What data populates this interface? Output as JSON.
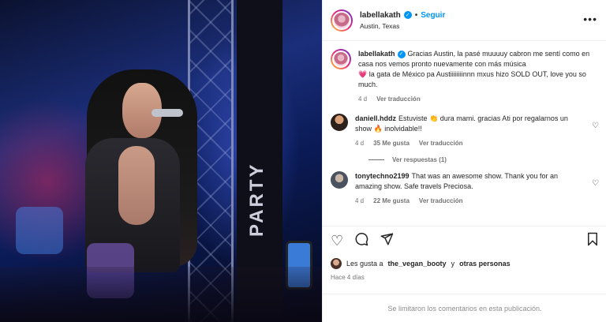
{
  "photo": {
    "banner_text": "PARTY"
  },
  "header": {
    "username": "labellakath",
    "verified_glyph": "✓",
    "separator": "•",
    "follow_label": "Seguir",
    "location": "Austin, Texas",
    "more_icon": "more-dots-icon"
  },
  "caption": {
    "username": "labellakath",
    "text_part1": "Gracias Austin, la pasé muuuuy cabron me sentí como en casa nos vemos pronto nuevamente con más música",
    "emoji_heart": "💗",
    "text_part2": "la gata de México pa Austiiiiiiiinnn mxus hizo SOLD OUT, love you so much.",
    "age": "4 d",
    "translate": "Ver traducción"
  },
  "comments": [
    {
      "username": "daniell.hddz",
      "text_part1": "Estuviste",
      "emoji1": "👏",
      "text_part2": "dura mami. gracias Ati por regalarnos un show",
      "emoji2": "🔥",
      "text_part3": "inolvidable!!",
      "age": "4 d",
      "likes": "35 Me gusta",
      "translate": "Ver traducción",
      "replies": "Ver respuestas (1)"
    },
    {
      "username": "tonytechno2199",
      "text": "That was an awesome show. Thank you for an amazing show. Safe travels Preciosa.",
      "age": "4 d",
      "likes": "22 Me gusta",
      "translate": "Ver traducción"
    }
  ],
  "actions": {
    "like_icon": "heart-outline-icon",
    "comment_icon": "comment-bubble-icon",
    "share_icon": "paper-plane-icon",
    "save_icon": "bookmark-icon"
  },
  "likes": {
    "prefix": "Les gusta a",
    "user": "the_vegan_booty",
    "middle": "y",
    "others": "otras personas"
  },
  "time": "Hace 4 días",
  "comments_limited": "Se limitaron los comentarios en esta publicación.",
  "colors": {
    "link_blue": "#0095f6",
    "text_dark": "#262626",
    "text_muted": "#737373",
    "border": "#efefef"
  }
}
